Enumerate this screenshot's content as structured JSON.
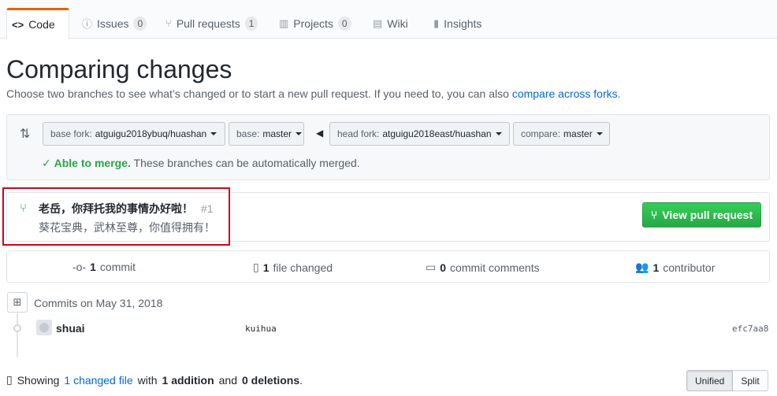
{
  "tabs": [
    {
      "label": "Code",
      "icon": "code-icon",
      "glyph": "<>"
    },
    {
      "label": "Issues",
      "count": "0",
      "icon": "issue-icon",
      "glyph": "ⓘ"
    },
    {
      "label": "Pull requests",
      "count": "1",
      "icon": "pull-request-icon",
      "glyph": "⑂"
    },
    {
      "label": "Projects",
      "count": "0",
      "icon": "project-icon",
      "glyph": "▥"
    },
    {
      "label": "Wiki",
      "icon": "book-icon",
      "glyph": "▤"
    },
    {
      "label": "Insights",
      "icon": "graph-icon",
      "glyph": "▮"
    }
  ],
  "page": {
    "title": "Comparing changes",
    "subtitle": "Choose two branches to see what’s changed or to start a new pull request. If you need to, you can also ",
    "subtitle_link": "compare across forks",
    "subtitle_end": "."
  },
  "range": {
    "base_fork_label": "base fork:",
    "base_fork": "atguigu2018ybuq/huashan",
    "base_label": "base:",
    "base": "master",
    "head_fork_label": "head fork:",
    "head_fork": "atguigu2018east/huashan",
    "compare_label": "compare:",
    "compare": "master",
    "merge_status": "Able to merge.",
    "merge_text": " These branches can be automatically merged."
  },
  "pull_request": {
    "title": "老岳，你拜托我的事情办好啦！",
    "number": "#1",
    "body": "葵花宝典，武林至尊，你值得拥有！",
    "button": "View pull request"
  },
  "stats": {
    "commits": "1",
    "commits_label": "commit",
    "files": "1",
    "files_label": "file changed",
    "comments": "0",
    "comments_label": "commit comments",
    "contributors": "1",
    "contributors_label": "contributor"
  },
  "commits": {
    "date": "Commits on May 31, 2018",
    "items": [
      {
        "author": "shuai",
        "message": "kuihua",
        "sha": "efc7aa8"
      }
    ]
  },
  "footer": {
    "showing": "Showing",
    "changed_link": "1 changed file",
    "with": "with",
    "additions": "1 addition",
    "and": "and",
    "deletions": "0 deletions",
    "period": ".",
    "unified": "Unified",
    "split": "Split"
  }
}
